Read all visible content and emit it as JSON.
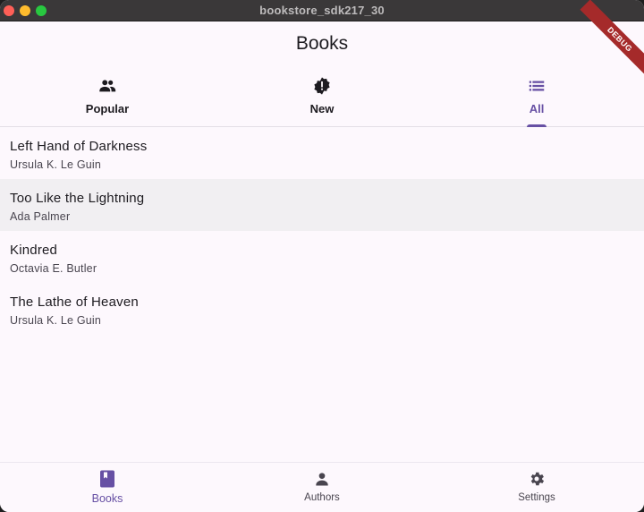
{
  "window": {
    "title": "bookstore_sdk217_30"
  },
  "debug_banner": "DEBUG",
  "appbar": {
    "title": "Books"
  },
  "tabs": [
    {
      "label": "Popular",
      "icon": "people-icon",
      "active": false
    },
    {
      "label": "New",
      "icon": "new-releases-icon",
      "active": false
    },
    {
      "label": "All",
      "icon": "list-icon",
      "active": true
    }
  ],
  "books": [
    {
      "title": "Left Hand of Darkness",
      "author": "Ursula K. Le Guin"
    },
    {
      "title": "Too Like the Lightning",
      "author": "Ada Palmer"
    },
    {
      "title": "Kindred",
      "author": "Octavia E. Butler"
    },
    {
      "title": "The Lathe of Heaven",
      "author": "Ursula K. Le Guin"
    }
  ],
  "bottom_nav": [
    {
      "label": "Books",
      "icon": "book-icon",
      "active": true
    },
    {
      "label": "Authors",
      "icon": "person-icon",
      "active": false
    },
    {
      "label": "Settings",
      "icon": "settings-icon",
      "active": false
    }
  ],
  "colors": {
    "accent": "#6750a4",
    "background": "#fdf8fd",
    "text": "#1d1b20",
    "muted": "#49454f"
  }
}
